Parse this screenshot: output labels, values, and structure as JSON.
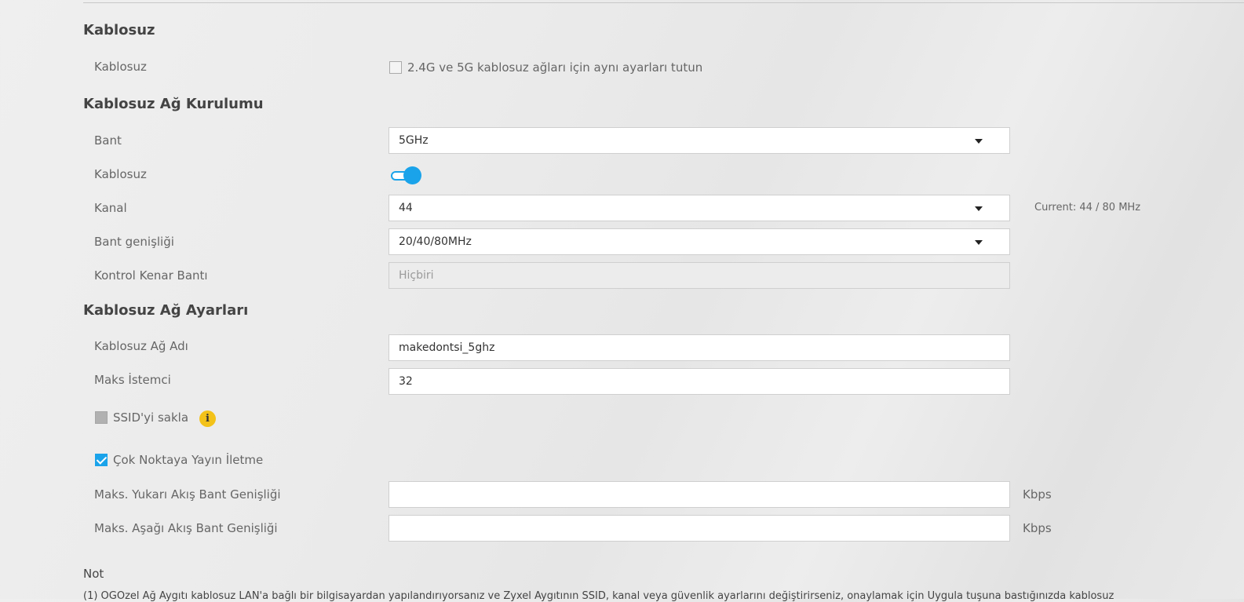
{
  "sections": {
    "wireless": "Kablosuz",
    "setup": "Kablosuz Ağ Kurulumu",
    "settings": "Kablosuz Ağ Ayarları"
  },
  "wireless": {
    "label": "Kablosuz",
    "same_settings_label": "2.4G ve 5G kablosuz ağları için aynı ayarları tutun",
    "same_settings_checked": false
  },
  "setup": {
    "band_label": "Bant",
    "band_value": "5GHz",
    "wireless_label": "Kablosuz",
    "wireless_enabled": true,
    "channel_label": "Kanal",
    "channel_value": "44",
    "channel_current": "Current: 44 / 80 MHz",
    "bandwidth_label": "Bant genişliği",
    "bandwidth_value": "20/40/80MHz",
    "control_sideband_label": "Kontrol Kenar Bantı",
    "control_sideband_value": "Hiçbiri"
  },
  "settings": {
    "ssid_label": "Kablosuz Ağ Adı",
    "ssid_value": "makedontsi_5ghz",
    "max_clients_label": "Maks İstemci",
    "max_clients_value": "32",
    "hide_ssid_label": "SSID'yi sakla",
    "hide_ssid_checked": false,
    "multicast_label": "Çok Noktaya Yayın İletme",
    "multicast_checked": true,
    "max_up_label": "Maks. Yukarı Akış Bant Genişliği",
    "max_up_value": "",
    "max_up_unit": "Kbps",
    "max_down_label": "Maks. Aşağı Akış Bant Genişliği",
    "max_down_value": "",
    "max_down_unit": "Kbps"
  },
  "note": {
    "title": "Not",
    "text": "(1) ÖĞÖzel Ağ Aygıtı kablosuz LAN'a bağlı bir bilgisayardan yapılandırıyorsanız ve Zyxel Aygıtının SSID, kanal veya güvenlik ayarlarını değiştirirseniz, onaylamak için Uygula tuşuna bastığınızda kablosuz"
  },
  "colors": {
    "accent": "#1aa3ea",
    "info": "#f3c219"
  }
}
